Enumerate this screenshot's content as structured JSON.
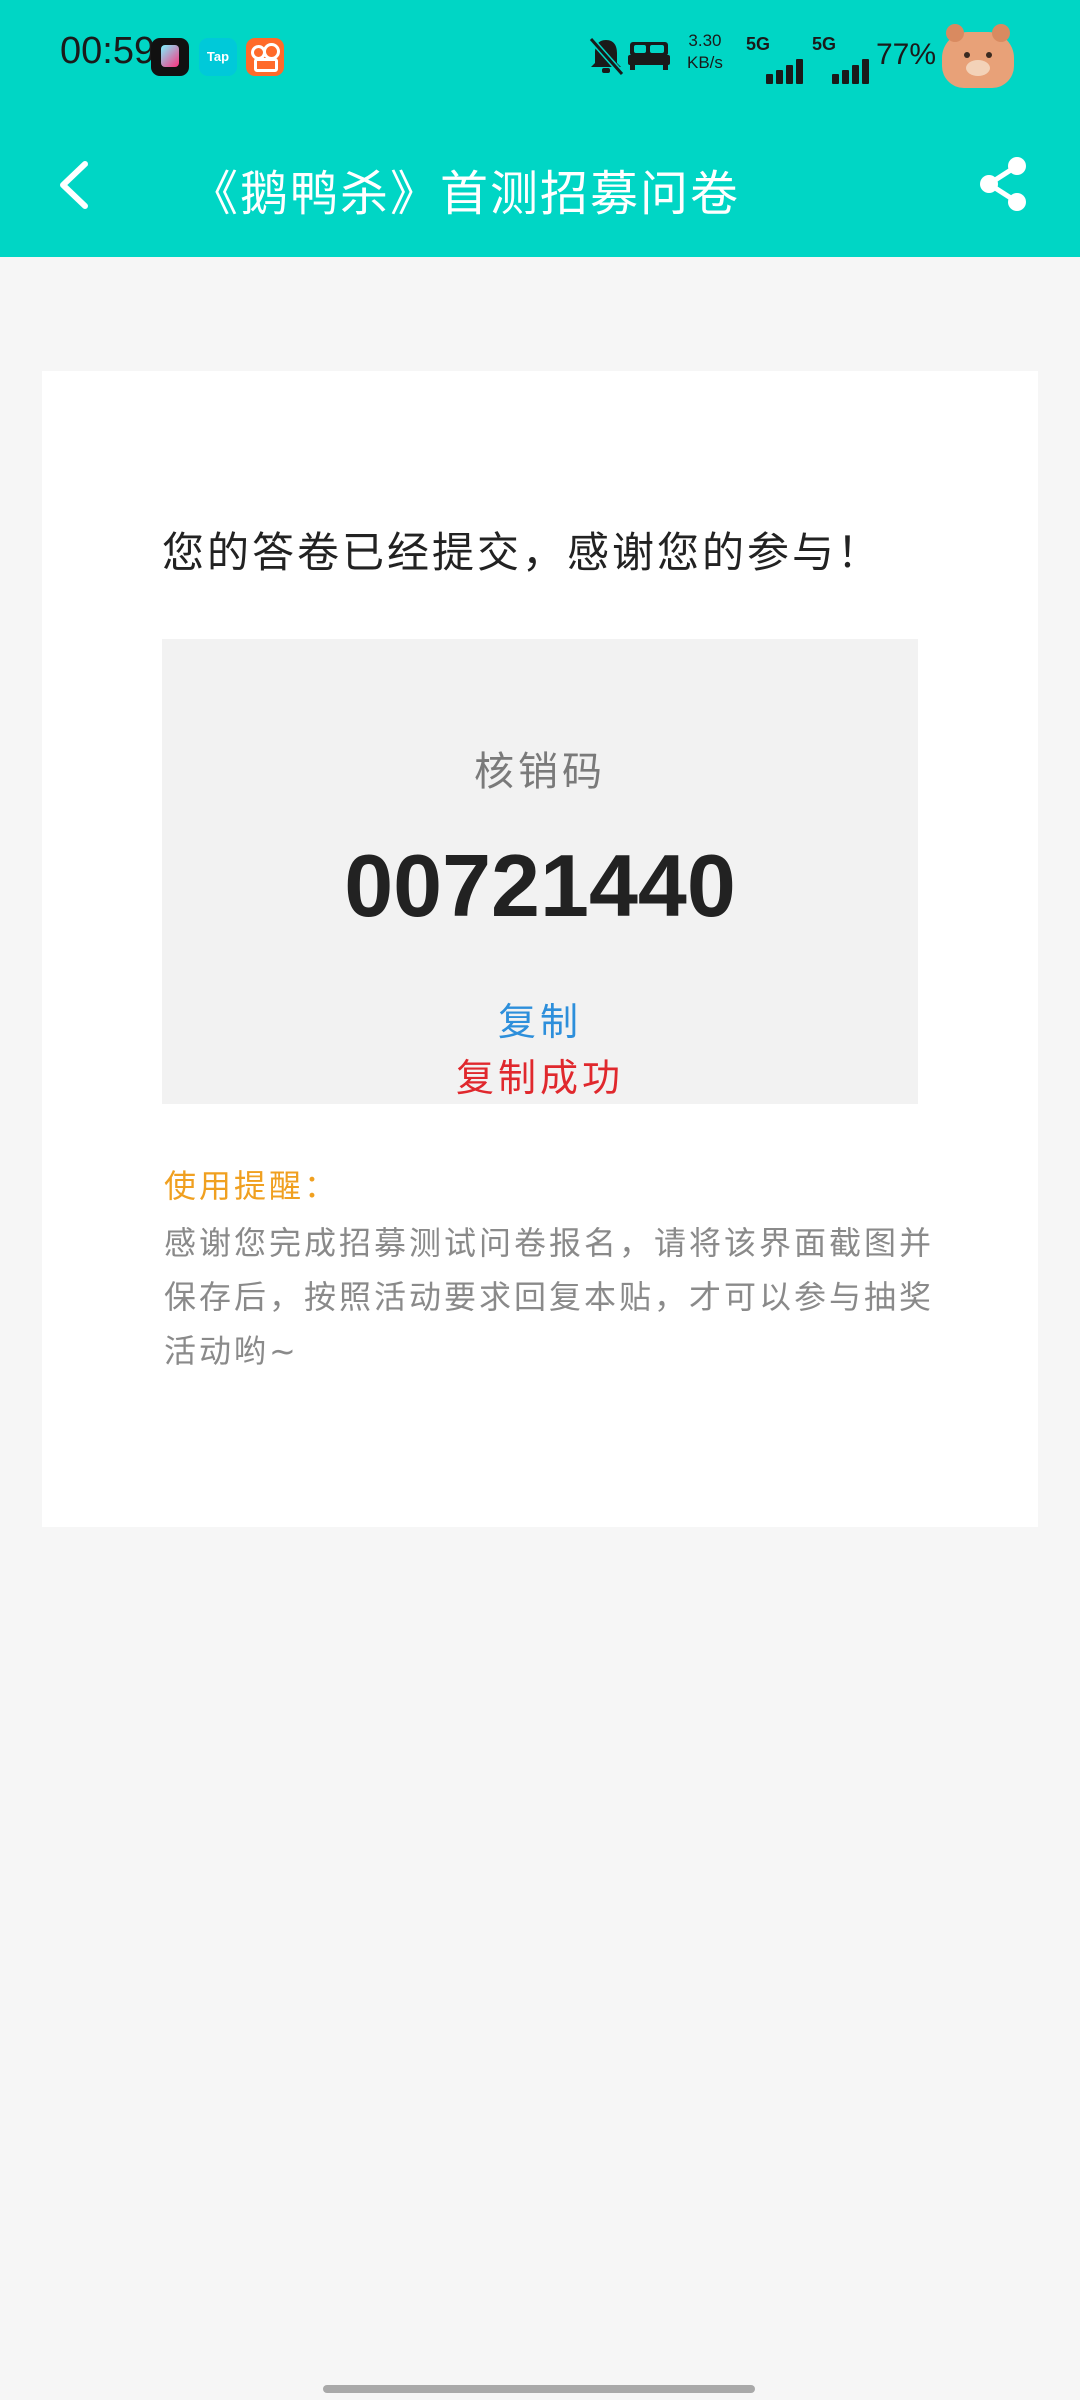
{
  "status_bar": {
    "time": "00:59",
    "app_icons": [
      "music-app-icon",
      "taptap-icon",
      "kuaishou-icon"
    ],
    "taptap_text": "Tap",
    "net_speed_value": "3.30",
    "net_speed_unit": "KB/s",
    "sim1_label": "5G",
    "sim2_label": "5G",
    "battery": "77%"
  },
  "nav": {
    "title": "《鹅鸭杀》首测招募问卷",
    "back_icon": "chevron-left-icon",
    "share_icon": "share-icon"
  },
  "result": {
    "message": "您的答卷已经提交，感谢您的参与！",
    "code_label": "核销码",
    "code_value": "00721440",
    "copy_button": "复制",
    "copy_success": "复制成功"
  },
  "tips": {
    "title": "使用提醒：",
    "body": "感谢您完成招募测试问卷报名，请将该界面截图并保存后，按照活动要求回复本贴，才可以参与抽奖活动哟~"
  },
  "colors": {
    "header": "#00d6c5",
    "copy": "#2d8fdb",
    "success": "#e0282d",
    "tip_title": "#f0a020"
  }
}
